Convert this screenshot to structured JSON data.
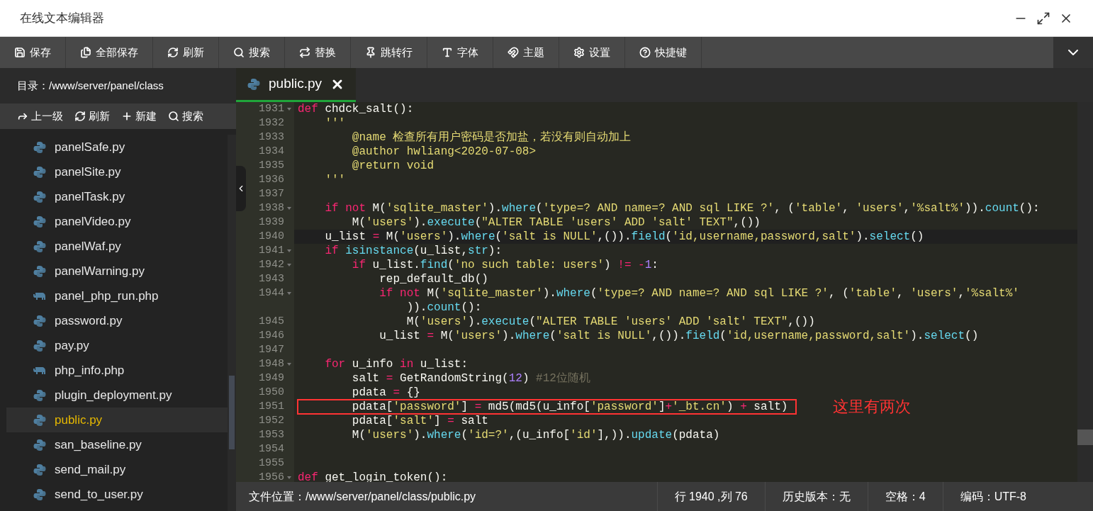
{
  "window": {
    "title": "在线文本编辑器"
  },
  "toolbar": [
    {
      "label": "保存"
    },
    {
      "label": "全部保存"
    },
    {
      "label": "刷新"
    },
    {
      "label": "搜索"
    },
    {
      "label": "替换"
    },
    {
      "label": "跳转行"
    },
    {
      "label": "字体"
    },
    {
      "label": "主题"
    },
    {
      "label": "设置"
    },
    {
      "label": "快捷键"
    }
  ],
  "sidebar": {
    "directory": "目录：/www/server/panel/class",
    "actions": [
      {
        "label": "上一级"
      },
      {
        "label": "刷新"
      },
      {
        "label": "新建"
      },
      {
        "label": "搜索"
      }
    ],
    "files": [
      {
        "name": "panelSafe.py",
        "kind": "python",
        "selected": false
      },
      {
        "name": "panelSite.py",
        "kind": "python",
        "selected": false
      },
      {
        "name": "panelTask.py",
        "kind": "python",
        "selected": false
      },
      {
        "name": "panelVideo.py",
        "kind": "python",
        "selected": false
      },
      {
        "name": "panelWaf.py",
        "kind": "python",
        "selected": false
      },
      {
        "name": "panelWarning.py",
        "kind": "python",
        "selected": false
      },
      {
        "name": "panel_php_run.php",
        "kind": "php",
        "selected": false
      },
      {
        "name": "password.py",
        "kind": "python",
        "selected": false
      },
      {
        "name": "pay.py",
        "kind": "python",
        "selected": false
      },
      {
        "name": "php_info.php",
        "kind": "php",
        "selected": false
      },
      {
        "name": "plugin_deployment.py",
        "kind": "python",
        "selected": false
      },
      {
        "name": "public.py",
        "kind": "python",
        "selected": true
      },
      {
        "name": "san_baseline.py",
        "kind": "python",
        "selected": false
      },
      {
        "name": "send_mail.py",
        "kind": "python",
        "selected": false
      },
      {
        "name": "send_to_user.py",
        "kind": "python",
        "selected": false
      }
    ]
  },
  "tabs": [
    {
      "label": "public.py",
      "selected": true
    }
  ],
  "code": [
    {
      "number": "1931",
      "fold": true,
      "tokens": [
        {
          "kind": "keyword",
          "text": "def"
        },
        {
          "kind": "plain",
          "text": " chdck_salt():"
        }
      ]
    },
    {
      "number": "1932",
      "tokens": [
        {
          "kind": "string",
          "text": "    '''"
        }
      ]
    },
    {
      "number": "1933",
      "tokens": [
        {
          "kind": "string",
          "text": "        @name 检查所有用户密码是否加盐，若没有则自动加上"
        }
      ]
    },
    {
      "number": "1934",
      "tokens": [
        {
          "kind": "string",
          "text": "        @author hwliang<2020-07-08>"
        }
      ]
    },
    {
      "number": "1935",
      "tokens": [
        {
          "kind": "string",
          "text": "        @return void"
        }
      ]
    },
    {
      "number": "1936",
      "tokens": [
        {
          "kind": "string",
          "text": "    '''"
        }
      ]
    },
    {
      "number": "1937"
    },
    {
      "number": "1938",
      "fold": true,
      "tokens": [
        {
          "kind": "keyword",
          "text": "    if not"
        },
        {
          "kind": "plain",
          "text": " M("
        },
        {
          "kind": "string",
          "text": "'sqlite_master'"
        },
        {
          "kind": "plain",
          "text": ")."
        },
        {
          "kind": "function",
          "text": "where"
        },
        {
          "kind": "plain",
          "text": "("
        },
        {
          "kind": "string",
          "text": "'type=? AND name=? AND sql LIKE ?'"
        },
        {
          "kind": "plain",
          "text": ", ("
        },
        {
          "kind": "string",
          "text": "'table'"
        },
        {
          "kind": "plain",
          "text": ", "
        },
        {
          "kind": "string",
          "text": "'users'"
        },
        {
          "kind": "plain",
          "text": ","
        },
        {
          "kind": "string",
          "text": "'%salt%'"
        },
        {
          "kind": "plain",
          "text": "))."
        },
        {
          "kind": "function",
          "text": "count"
        },
        {
          "kind": "plain",
          "text": "():"
        }
      ]
    },
    {
      "number": "1939",
      "tokens": [
        {
          "kind": "plain",
          "text": "        M("
        },
        {
          "kind": "string",
          "text": "'users'"
        },
        {
          "kind": "plain",
          "text": ")."
        },
        {
          "kind": "function",
          "text": "execute"
        },
        {
          "kind": "plain",
          "text": "("
        },
        {
          "kind": "string",
          "text": "\"ALTER TABLE 'users' ADD 'salt' TEXT\""
        },
        {
          "kind": "plain",
          "text": ",())"
        }
      ]
    },
    {
      "number": "1940",
      "active": true,
      "tokens": [
        {
          "kind": "plain",
          "text": "    u_list "
        },
        {
          "kind": "keyword",
          "text": "="
        },
        {
          "kind": "plain",
          "text": " M("
        },
        {
          "kind": "string",
          "text": "'users'"
        },
        {
          "kind": "plain",
          "text": ")."
        },
        {
          "kind": "function",
          "text": "where"
        },
        {
          "kind": "plain",
          "text": "("
        },
        {
          "kind": "string",
          "text": "'salt is NULL'"
        },
        {
          "kind": "plain",
          "text": ",())."
        },
        {
          "kind": "function",
          "text": "field"
        },
        {
          "kind": "plain",
          "text": "("
        },
        {
          "kind": "string",
          "text": "'id,username,password,salt'"
        },
        {
          "kind": "plain",
          "text": ")."
        },
        {
          "kind": "function",
          "text": "select"
        },
        {
          "kind": "plain",
          "text": "()"
        }
      ]
    },
    {
      "number": "1941",
      "fold": true,
      "tokens": [
        {
          "kind": "keyword",
          "text": "    if "
        },
        {
          "kind": "function",
          "text": "isinstance"
        },
        {
          "kind": "plain",
          "text": "(u_list,"
        },
        {
          "kind": "function",
          "text": "str"
        },
        {
          "kind": "plain",
          "text": "):"
        }
      ]
    },
    {
      "number": "1942",
      "fold": true,
      "tokens": [
        {
          "kind": "keyword",
          "text": "        if"
        },
        {
          "kind": "plain",
          "text": " u_list."
        },
        {
          "kind": "function",
          "text": "find"
        },
        {
          "kind": "plain",
          "text": "("
        },
        {
          "kind": "string",
          "text": "'no such table: users'"
        },
        {
          "kind": "plain",
          "text": ") "
        },
        {
          "kind": "keyword",
          "text": "!= -"
        },
        {
          "kind": "number",
          "text": "1"
        },
        {
          "kind": "plain",
          "text": ":"
        }
      ]
    },
    {
      "number": "1943",
      "tokens": [
        {
          "kind": "plain",
          "text": "            rep_default_db()"
        }
      ]
    },
    {
      "number": "1944",
      "fold": true,
      "tokens": [
        {
          "kind": "keyword",
          "text": "            if not"
        },
        {
          "kind": "plain",
          "text": " M("
        },
        {
          "kind": "string",
          "text": "'sqlite_master'"
        },
        {
          "kind": "plain",
          "text": ")."
        },
        {
          "kind": "function",
          "text": "where"
        },
        {
          "kind": "plain",
          "text": "("
        },
        {
          "kind": "string",
          "text": "'type=? AND name=? AND sql LIKE ?'"
        },
        {
          "kind": "plain",
          "text": ", ("
        },
        {
          "kind": "string",
          "text": "'table'"
        },
        {
          "kind": "plain",
          "text": ", "
        },
        {
          "kind": "string",
          "text": "'users'"
        },
        {
          "kind": "plain",
          "text": ","
        },
        {
          "kind": "string",
          "text": "'%salt%'"
        }
      ]
    },
    {
      "tokens": [
        {
          "kind": "plain",
          "text": "                ))."
        },
        {
          "kind": "function",
          "text": "count"
        },
        {
          "kind": "plain",
          "text": "():"
        }
      ]
    },
    {
      "number": "1945",
      "tokens": [
        {
          "kind": "plain",
          "text": "                M("
        },
        {
          "kind": "string",
          "text": "'users'"
        },
        {
          "kind": "plain",
          "text": ")."
        },
        {
          "kind": "function",
          "text": "execute"
        },
        {
          "kind": "plain",
          "text": "("
        },
        {
          "kind": "string",
          "text": "\"ALTER TABLE 'users' ADD 'salt' TEXT\""
        },
        {
          "kind": "plain",
          "text": ",())"
        }
      ]
    },
    {
      "number": "1946",
      "tokens": [
        {
          "kind": "plain",
          "text": "            u_list "
        },
        {
          "kind": "keyword",
          "text": "="
        },
        {
          "kind": "plain",
          "text": " M("
        },
        {
          "kind": "string",
          "text": "'users'"
        },
        {
          "kind": "plain",
          "text": ")."
        },
        {
          "kind": "function",
          "text": "where"
        },
        {
          "kind": "plain",
          "text": "("
        },
        {
          "kind": "string",
          "text": "'salt is NULL'"
        },
        {
          "kind": "plain",
          "text": ",())."
        },
        {
          "kind": "function",
          "text": "field"
        },
        {
          "kind": "plain",
          "text": "("
        },
        {
          "kind": "string",
          "text": "'id,username,password,salt'"
        },
        {
          "kind": "plain",
          "text": ")."
        },
        {
          "kind": "function",
          "text": "select"
        },
        {
          "kind": "plain",
          "text": "()"
        }
      ]
    },
    {
      "number": "1947"
    },
    {
      "number": "1948",
      "fold": true,
      "tokens": [
        {
          "kind": "keyword",
          "text": "    for"
        },
        {
          "kind": "plain",
          "text": " u_info "
        },
        {
          "kind": "keyword",
          "text": "in"
        },
        {
          "kind": "plain",
          "text": " u_list:"
        }
      ]
    },
    {
      "number": "1949",
      "tokens": [
        {
          "kind": "plain",
          "text": "        salt "
        },
        {
          "kind": "keyword",
          "text": "="
        },
        {
          "kind": "plain",
          "text": " GetRandomString("
        },
        {
          "kind": "number",
          "text": "12"
        },
        {
          "kind": "plain",
          "text": ") "
        },
        {
          "kind": "comment",
          "text": "#12位随机"
        }
      ]
    },
    {
      "number": "1950",
      "tokens": [
        {
          "kind": "plain",
          "text": "        pdata "
        },
        {
          "kind": "keyword",
          "text": "="
        },
        {
          "kind": "plain",
          "text": " {}"
        }
      ]
    },
    {
      "number": "1951",
      "highlighted": true,
      "note": "这里有两次",
      "tokens": [
        {
          "kind": "plain",
          "text": "        pdata["
        },
        {
          "kind": "string",
          "text": "'password'"
        },
        {
          "kind": "plain",
          "text": "] "
        },
        {
          "kind": "keyword",
          "text": "="
        },
        {
          "kind": "plain",
          "text": " md5(md5(u_info["
        },
        {
          "kind": "string",
          "text": "'password'"
        },
        {
          "kind": "plain",
          "text": "]"
        },
        {
          "kind": "keyword",
          "text": "+"
        },
        {
          "kind": "string",
          "text": "'_bt.cn'"
        },
        {
          "kind": "plain",
          "text": ") "
        },
        {
          "kind": "keyword",
          "text": "+"
        },
        {
          "kind": "plain",
          "text": " salt)"
        }
      ]
    },
    {
      "number": "1952",
      "tokens": [
        {
          "kind": "plain",
          "text": "        pdata["
        },
        {
          "kind": "string",
          "text": "'salt'"
        },
        {
          "kind": "plain",
          "text": "] "
        },
        {
          "kind": "keyword",
          "text": "="
        },
        {
          "kind": "plain",
          "text": " salt"
        }
      ]
    },
    {
      "number": "1953",
      "tokens": [
        {
          "kind": "plain",
          "text": "        M("
        },
        {
          "kind": "string",
          "text": "'users'"
        },
        {
          "kind": "plain",
          "text": ")."
        },
        {
          "kind": "function",
          "text": "where"
        },
        {
          "kind": "plain",
          "text": "("
        },
        {
          "kind": "string",
          "text": "'id=?'"
        },
        {
          "kind": "plain",
          "text": ",(u_info["
        },
        {
          "kind": "string",
          "text": "'id'"
        },
        {
          "kind": "plain",
          "text": "],))."
        },
        {
          "kind": "function",
          "text": "update"
        },
        {
          "kind": "plain",
          "text": "(pdata)"
        }
      ]
    },
    {
      "number": "1954"
    },
    {
      "number": "1955"
    },
    {
      "number": "1956",
      "fold": true,
      "tokens": [
        {
          "kind": "keyword",
          "text": "def"
        },
        {
          "kind": "plain",
          "text": " get_login_token():"
        }
      ]
    }
  ],
  "status_bar": {
    "path": "文件位置：/www/server/panel/class/public.py",
    "items": [
      "行 1940 ,列 76",
      "历史版本：无",
      "空格：4",
      "编码：UTF-8"
    ]
  }
}
